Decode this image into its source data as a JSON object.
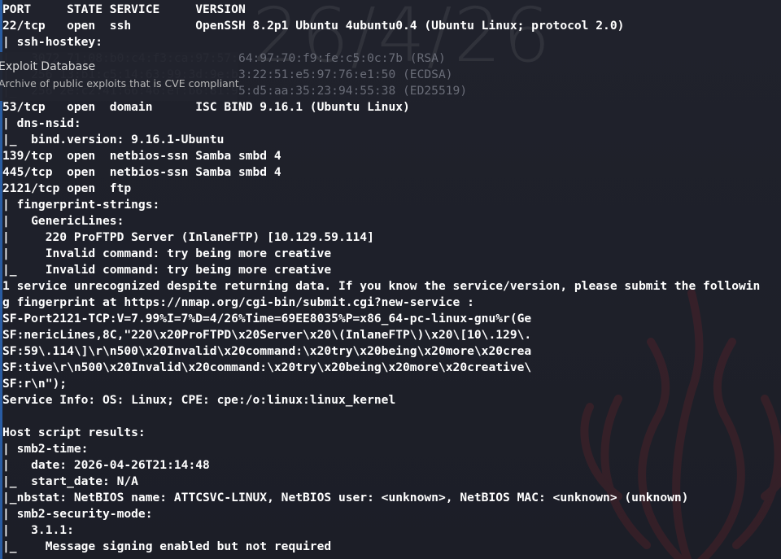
{
  "watermark": {
    "date": "26/4/26"
  },
  "tooltip": {
    "title": "Exploit Database",
    "subtitle": "Archive of public exploits that is CVE compliant"
  },
  "lines": [
    "PORT     STATE SERVICE     VERSION",
    "22/tcp   open  ssh         OpenSSH 8.2p1 Ubuntu 4ubuntu0.4 (Ubuntu Linux; protocol 2.0)",
    "| ssh-hostkey:",
    "|   3072 71:08:b0:c4:f3:ca:97:57:64:97:70:f9:fe:c5:0c:7b (RSA)",
    "|   256 13:b1:c5:14:63:99:3d:9e:b3:22:51:e5:97:76:e1:50 (ECDSA)",
    "|_  256 2e:c2:41:66:46:ef:b6:81:95:d5:aa:35:23:94:55:38 (ED25519)",
    "53/tcp   open  domain      ISC BIND 9.16.1 (Ubuntu Linux)",
    "| dns-nsid:",
    "|_  bind.version: 9.16.1-Ubuntu",
    "139/tcp  open  netbios-ssn Samba smbd 4",
    "445/tcp  open  netbios-ssn Samba smbd 4",
    "2121/tcp open  ftp",
    "| fingerprint-strings:",
    "|   GenericLines:",
    "|     220 ProFTPD Server (InlaneFTP) [10.129.59.114]",
    "|     Invalid command: try being more creative",
    "|_    Invalid command: try being more creative",
    "1 service unrecognized despite returning data. If you know the service/version, please submit the followin",
    "g fingerprint at https://nmap.org/cgi-bin/submit.cgi?new-service :",
    "SF-Port2121-TCP:V=7.99%I=7%D=4/26%Time=69EE8035%P=x86_64-pc-linux-gnu%r(Ge",
    "SF:nericLines,8C,\"220\\x20ProFTPD\\x20Server\\x20\\(InlaneFTP\\)\\x20\\[10\\.129\\.",
    "SF:59\\.114\\]\\r\\n500\\x20Invalid\\x20command:\\x20try\\x20being\\x20more\\x20crea",
    "SF:tive\\r\\n500\\x20Invalid\\x20command:\\x20try\\x20being\\x20more\\x20creative\\",
    "SF:r\\n\");",
    "Service Info: OS: Linux; CPE: cpe:/o:linux:linux_kernel",
    "",
    "Host script results:",
    "| smb2-time:",
    "|   date: 2026-04-26T21:14:48",
    "|_  start_date: N/A",
    "|_nbstat: NetBIOS name: ATTCSVC-LINUX, NetBIOS user: <unknown>, NetBIOS MAC: <unknown> (unknown)",
    "| smb2-security-mode:",
    "|   3.1.1:",
    "|_    Message signing enabled but not required"
  ]
}
